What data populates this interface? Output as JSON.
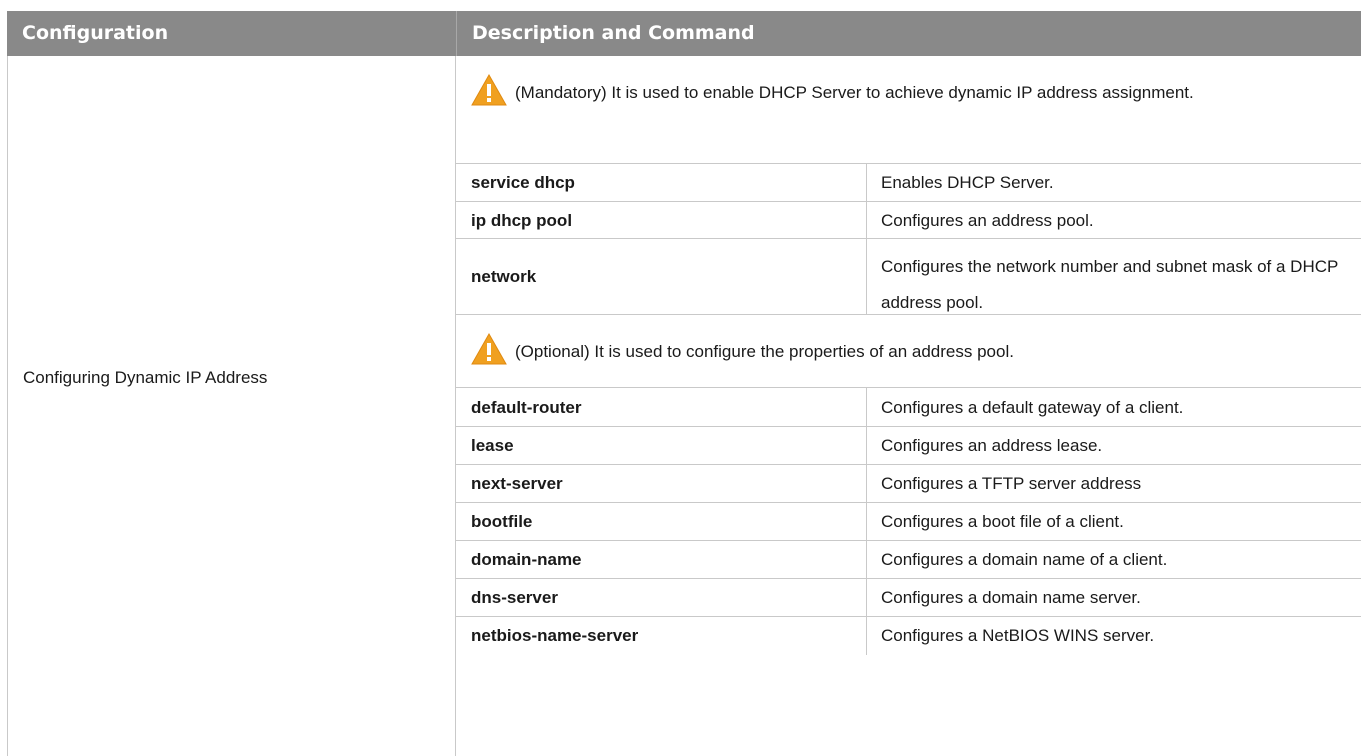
{
  "header": {
    "col1": "Configuration",
    "col2": "Description and Command",
    "bg_color": "#898989"
  },
  "configuration_name": "Configuring Dynamic IP Address",
  "sections": [
    {
      "note_icon": "warning-icon",
      "note": "(Mandatory) It is used to enable DHCP Server to achieve dynamic IP address assignment.",
      "rows": [
        {
          "command": "service dhcp",
          "description": "Enables DHCP Server."
        },
        {
          "command": "ip dhcp pool",
          "description": "Configures an address pool."
        },
        {
          "command": "network",
          "description": "Configures the network number and subnet mask of a DHCP address pool."
        }
      ]
    },
    {
      "note_icon": "warning-icon",
      "note": "(Optional) It is used to configure the properties of an address pool.",
      "rows": [
        {
          "command": "default-router",
          "description": "Configures a default gateway of a client."
        },
        {
          "command": "lease",
          "description": "Configures an address lease."
        },
        {
          "command": "next-server",
          "description": "Configures a TFTP server address"
        },
        {
          "command": "bootfile",
          "description": "Configures a boot file of a client."
        },
        {
          "command": "domain-name",
          "description": "Configures a domain name of a client."
        },
        {
          "command": "dns-server",
          "description": "Configures a domain name server."
        },
        {
          "command": "netbios-name-server",
          "description": "Configures a NetBIOS WINS server."
        }
      ]
    }
  ]
}
